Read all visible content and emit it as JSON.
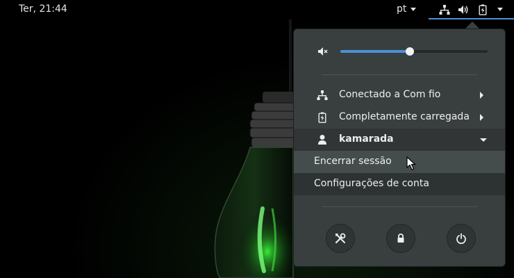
{
  "topbar": {
    "clock": "Ter, 21:44",
    "language": "pt",
    "status_icons": [
      "network-wired-icon",
      "volume-icon",
      "battery-charging-icon",
      "chevron-down-icon"
    ]
  },
  "menu": {
    "volume": {
      "icon": "speaker-muted-icon",
      "level": 0.47
    },
    "network": {
      "label": "Conectado a Com fio",
      "icon": "network-wired-icon"
    },
    "battery": {
      "label": "Completamente carregada",
      "icon": "battery-charging-icon"
    },
    "user": {
      "name": "kamarada",
      "icon": "person-icon",
      "items": [
        {
          "label": "Encerrar sessão"
        },
        {
          "label": "Configurações de conta"
        }
      ]
    },
    "actions": [
      {
        "icon": "settings-tools-icon"
      },
      {
        "icon": "lock-icon"
      },
      {
        "icon": "power-icon"
      }
    ]
  },
  "colors": {
    "accent": "#4a90d9",
    "menu_bg": "#393f3f",
    "bulb_glow": "#2fb32f"
  }
}
